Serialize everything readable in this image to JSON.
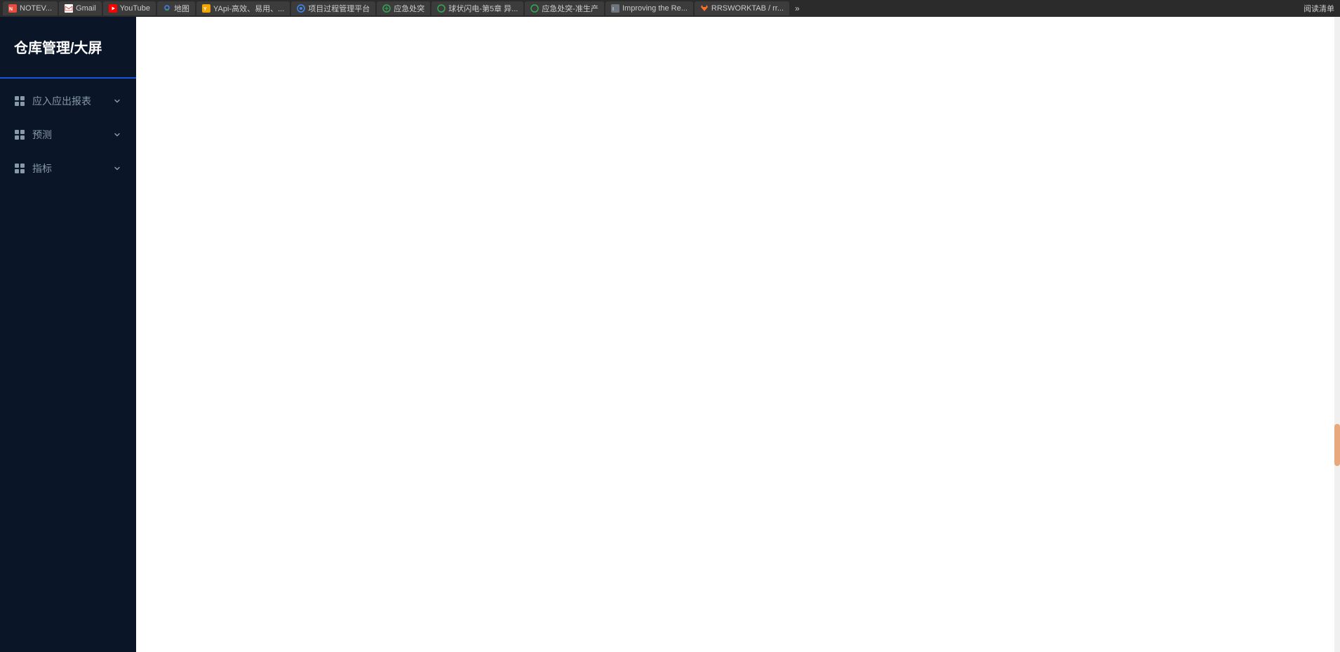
{
  "browser": {
    "tabs": [
      {
        "id": "tab-notev",
        "label": "NOTEV...",
        "favicon_type": "notev",
        "active": false
      },
      {
        "id": "tab-gmail",
        "label": "Gmail",
        "favicon_type": "gmail",
        "active": false
      },
      {
        "id": "tab-youtube",
        "label": "YouTube",
        "favicon_type": "youtube",
        "active": false
      },
      {
        "id": "tab-maps",
        "label": "地图",
        "favicon_type": "maps",
        "active": false
      },
      {
        "id": "tab-yapi",
        "label": "YApi-高效、易用、...",
        "favicon_type": "yapi",
        "active": false
      },
      {
        "id": "tab-project",
        "label": "项目过程管理平台",
        "favicon_type": "generic",
        "active": false
      },
      {
        "id": "tab-emergency1",
        "label": "应急处突",
        "favicon_type": "globe",
        "active": false
      },
      {
        "id": "tab-flash",
        "label": "球状闪电-第5章 异...",
        "favicon_type": "globe",
        "active": false
      },
      {
        "id": "tab-emergency2",
        "label": "应急处突-准生产",
        "favicon_type": "globe",
        "active": false
      },
      {
        "id": "tab-improving",
        "label": "Improving the Re...",
        "favicon_type": "improving",
        "active": false
      },
      {
        "id": "tab-gitlab",
        "label": "RRSWORKTAB / rr...",
        "favicon_type": "gitlab",
        "active": false
      }
    ],
    "more_label": "»",
    "action_read": "阅读清单"
  },
  "sidebar": {
    "title": "仓库管理/大屏",
    "nav_items": [
      {
        "id": "nav-reports",
        "label": "应入应出报表",
        "icon": "grid"
      },
      {
        "id": "nav-forecast",
        "label": "预测",
        "icon": "grid"
      },
      {
        "id": "nav-indicators",
        "label": "指标",
        "icon": "grid"
      }
    ]
  },
  "colors": {
    "sidebar_bg": "#0a1628",
    "sidebar_divider": "#1a56db",
    "nav_text": "#8899aa",
    "title_text": "#ffffff"
  }
}
